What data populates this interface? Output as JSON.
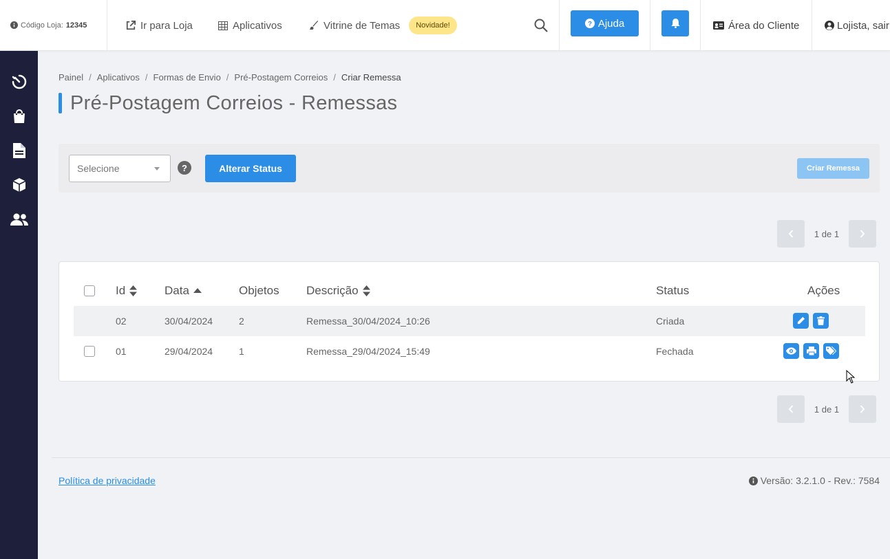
{
  "header": {
    "store_code_label": "Código Loja:",
    "store_code_value": "12345",
    "nav": {
      "go_to_store": "Ir para Loja",
      "apps": "Aplicativos",
      "themes": "Vitrine de Temas",
      "new_badge": "Novidade!"
    },
    "help_label": "Ajuda",
    "client_area": "Área do Cliente",
    "user_label": "Lojista, sair"
  },
  "breadcrumb": [
    "Painel",
    "Aplicativos",
    "Formas de Envio",
    "Pré-Postagem Correios",
    "Criar Remessa"
  ],
  "page_title": "Pré-Postagem Correios - Remessas",
  "actions": {
    "select_placeholder": "Selecione",
    "help_glyph": "?",
    "change_status": "Alterar Status",
    "create_shipment": "Criar Remessa"
  },
  "pagination": {
    "text": "1 de 1"
  },
  "table": {
    "columns": {
      "id": "Id",
      "date": "Data",
      "objects": "Objetos",
      "description": "Descrição",
      "status": "Status",
      "actions": "Ações"
    },
    "rows": [
      {
        "id": "02",
        "date": "30/04/2024",
        "objects": "2",
        "description": "Remessa_30/04/2024_10:26",
        "status": "Criada"
      },
      {
        "id": "01",
        "date": "29/04/2024",
        "objects": "1",
        "description": "Remessa_29/04/2024_15:49",
        "status": "Fechada"
      }
    ]
  },
  "footer": {
    "privacy": "Política de privacidade",
    "version": "Versão: 3.2.1.0 - Rev.: 7584"
  },
  "colors": {
    "primary": "#2b8de5",
    "sidebar": "#1e1f3b",
    "badge": "#fde68a"
  }
}
